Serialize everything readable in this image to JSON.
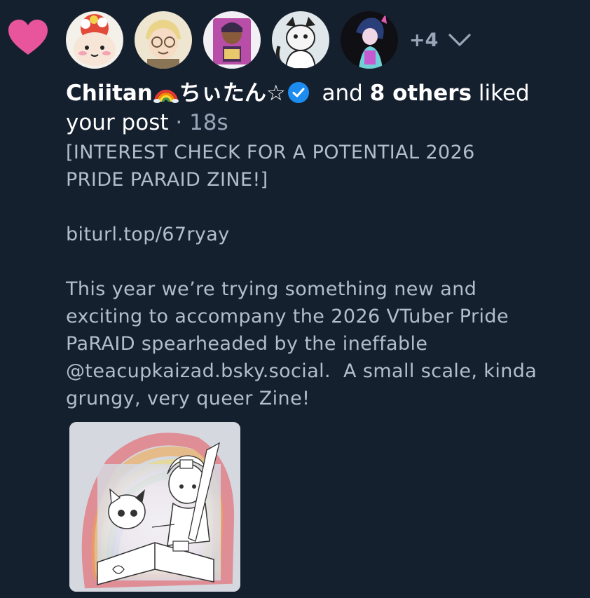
{
  "notification": {
    "icon": "heart-icon",
    "heart_color": "#e8559c",
    "more_count": "+4",
    "liker_name": "Chiitan",
    "liker_name_suffix": "ちぃたん☆",
    "liker_emoji": "rainbow-emoji",
    "verified_icon": "verified-check-icon",
    "and_text": " and ",
    "others_text": "8 others",
    "action_text": " liked your post",
    "separator": " · ",
    "time": "18s"
  },
  "avatars": [
    {
      "name": "avatar-1"
    },
    {
      "name": "avatar-2"
    },
    {
      "name": "avatar-3"
    },
    {
      "name": "avatar-4"
    },
    {
      "name": "avatar-5"
    }
  ],
  "post": {
    "text": "[INTEREST CHECK FOR A POTENTIAL 2026\nPRIDE PARAID ZINE!]\n\nbiturl.top/67ryay\n\nThis year we’re trying something new and\nexciting to accompany the 2026 VTuber Pride\nPaRAID spearheaded by the ineffable\n@teacupkaizad.bsky.social.  A small scale, kinda\ngrungy, very queer Zine!",
    "image_icon": "post-image-thumbnail"
  },
  "colors": {
    "background": "#15202f",
    "text_primary": "#ffffff",
    "text_secondary": "#b3bdcb",
    "muted": "#9aa6b8",
    "verified": "#1d8cf0"
  }
}
